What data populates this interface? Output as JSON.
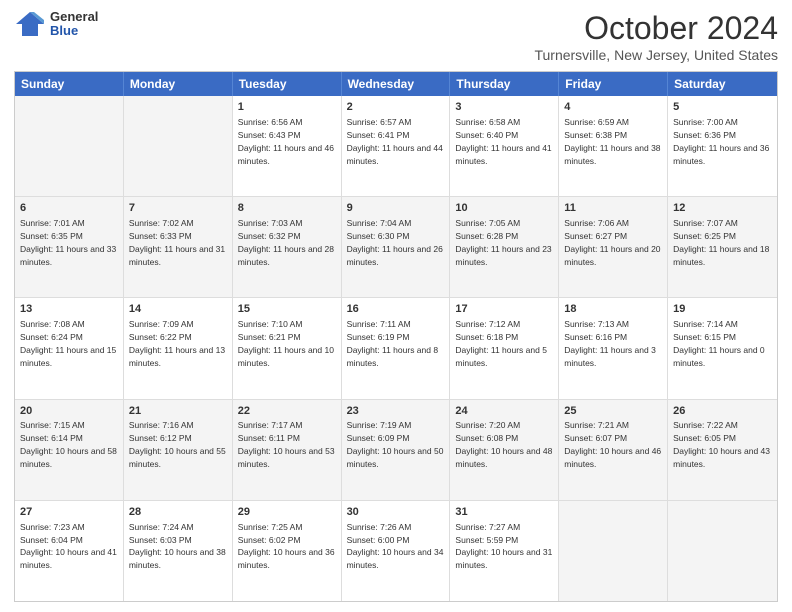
{
  "header": {
    "logo": {
      "general": "General",
      "blue": "Blue"
    },
    "title": "October 2024",
    "subtitle": "Turnersville, New Jersey, United States"
  },
  "calendar": {
    "days": [
      "Sunday",
      "Monday",
      "Tuesday",
      "Wednesday",
      "Thursday",
      "Friday",
      "Saturday"
    ],
    "rows": [
      [
        {
          "day": "",
          "info": ""
        },
        {
          "day": "",
          "info": ""
        },
        {
          "day": "1",
          "info": "Sunrise: 6:56 AM\nSunset: 6:43 PM\nDaylight: 11 hours and 46 minutes."
        },
        {
          "day": "2",
          "info": "Sunrise: 6:57 AM\nSunset: 6:41 PM\nDaylight: 11 hours and 44 minutes."
        },
        {
          "day": "3",
          "info": "Sunrise: 6:58 AM\nSunset: 6:40 PM\nDaylight: 11 hours and 41 minutes."
        },
        {
          "day": "4",
          "info": "Sunrise: 6:59 AM\nSunset: 6:38 PM\nDaylight: 11 hours and 38 minutes."
        },
        {
          "day": "5",
          "info": "Sunrise: 7:00 AM\nSunset: 6:36 PM\nDaylight: 11 hours and 36 minutes."
        }
      ],
      [
        {
          "day": "6",
          "info": "Sunrise: 7:01 AM\nSunset: 6:35 PM\nDaylight: 11 hours and 33 minutes."
        },
        {
          "day": "7",
          "info": "Sunrise: 7:02 AM\nSunset: 6:33 PM\nDaylight: 11 hours and 31 minutes."
        },
        {
          "day": "8",
          "info": "Sunrise: 7:03 AM\nSunset: 6:32 PM\nDaylight: 11 hours and 28 minutes."
        },
        {
          "day": "9",
          "info": "Sunrise: 7:04 AM\nSunset: 6:30 PM\nDaylight: 11 hours and 26 minutes."
        },
        {
          "day": "10",
          "info": "Sunrise: 7:05 AM\nSunset: 6:28 PM\nDaylight: 11 hours and 23 minutes."
        },
        {
          "day": "11",
          "info": "Sunrise: 7:06 AM\nSunset: 6:27 PM\nDaylight: 11 hours and 20 minutes."
        },
        {
          "day": "12",
          "info": "Sunrise: 7:07 AM\nSunset: 6:25 PM\nDaylight: 11 hours and 18 minutes."
        }
      ],
      [
        {
          "day": "13",
          "info": "Sunrise: 7:08 AM\nSunset: 6:24 PM\nDaylight: 11 hours and 15 minutes."
        },
        {
          "day": "14",
          "info": "Sunrise: 7:09 AM\nSunset: 6:22 PM\nDaylight: 11 hours and 13 minutes."
        },
        {
          "day": "15",
          "info": "Sunrise: 7:10 AM\nSunset: 6:21 PM\nDaylight: 11 hours and 10 minutes."
        },
        {
          "day": "16",
          "info": "Sunrise: 7:11 AM\nSunset: 6:19 PM\nDaylight: 11 hours and 8 minutes."
        },
        {
          "day": "17",
          "info": "Sunrise: 7:12 AM\nSunset: 6:18 PM\nDaylight: 11 hours and 5 minutes."
        },
        {
          "day": "18",
          "info": "Sunrise: 7:13 AM\nSunset: 6:16 PM\nDaylight: 11 hours and 3 minutes."
        },
        {
          "day": "19",
          "info": "Sunrise: 7:14 AM\nSunset: 6:15 PM\nDaylight: 11 hours and 0 minutes."
        }
      ],
      [
        {
          "day": "20",
          "info": "Sunrise: 7:15 AM\nSunset: 6:14 PM\nDaylight: 10 hours and 58 minutes."
        },
        {
          "day": "21",
          "info": "Sunrise: 7:16 AM\nSunset: 6:12 PM\nDaylight: 10 hours and 55 minutes."
        },
        {
          "day": "22",
          "info": "Sunrise: 7:17 AM\nSunset: 6:11 PM\nDaylight: 10 hours and 53 minutes."
        },
        {
          "day": "23",
          "info": "Sunrise: 7:19 AM\nSunset: 6:09 PM\nDaylight: 10 hours and 50 minutes."
        },
        {
          "day": "24",
          "info": "Sunrise: 7:20 AM\nSunset: 6:08 PM\nDaylight: 10 hours and 48 minutes."
        },
        {
          "day": "25",
          "info": "Sunrise: 7:21 AM\nSunset: 6:07 PM\nDaylight: 10 hours and 46 minutes."
        },
        {
          "day": "26",
          "info": "Sunrise: 7:22 AM\nSunset: 6:05 PM\nDaylight: 10 hours and 43 minutes."
        }
      ],
      [
        {
          "day": "27",
          "info": "Sunrise: 7:23 AM\nSunset: 6:04 PM\nDaylight: 10 hours and 41 minutes."
        },
        {
          "day": "28",
          "info": "Sunrise: 7:24 AM\nSunset: 6:03 PM\nDaylight: 10 hours and 38 minutes."
        },
        {
          "day": "29",
          "info": "Sunrise: 7:25 AM\nSunset: 6:02 PM\nDaylight: 10 hours and 36 minutes."
        },
        {
          "day": "30",
          "info": "Sunrise: 7:26 AM\nSunset: 6:00 PM\nDaylight: 10 hours and 34 minutes."
        },
        {
          "day": "31",
          "info": "Sunrise: 7:27 AM\nSunset: 5:59 PM\nDaylight: 10 hours and 31 minutes."
        },
        {
          "day": "",
          "info": ""
        },
        {
          "day": "",
          "info": ""
        }
      ]
    ]
  }
}
